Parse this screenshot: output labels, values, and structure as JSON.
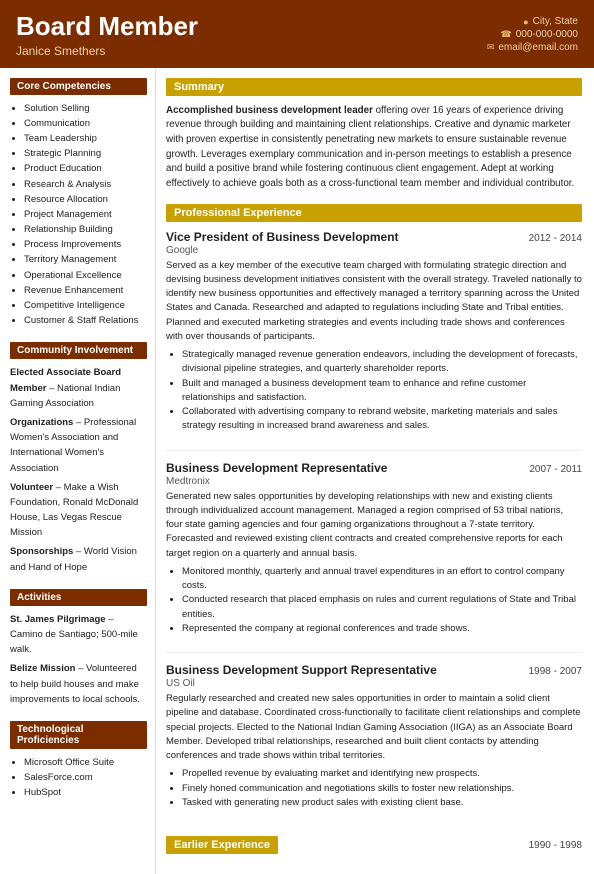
{
  "header": {
    "name": "Board Member",
    "subtitle": "Janice Smethers",
    "contact": {
      "location": "City, State",
      "phone": "000-000-0000",
      "email": "email@email.com"
    }
  },
  "sidebar": {
    "core_competencies": {
      "title": "Core Competencies",
      "items": [
        "Solution Selling",
        "Communication",
        "Team Leadership",
        "Strategic Planning",
        "Product Education",
        "Research & Analysis",
        "Resource Allocation",
        "Project Management",
        "Relationship Building",
        "Process Improvements",
        "Territory Management",
        "Operational Excellence",
        "Revenue Enhancement",
        "Competitive Intelligence",
        "Customer & Staff Relations"
      ]
    },
    "community": {
      "title": "Community Involvement",
      "items": [
        {
          "bold": "Elected Associate Board Member",
          "normal": " – National Indian Gaming Association"
        },
        {
          "bold": "Organizations",
          "normal": " – Professional Women's Association and International Women's Association"
        },
        {
          "bold": "Volunteer",
          "normal": " – Make a Wish Foundation, Ronald McDonald House, Las Vegas Rescue Mission"
        },
        {
          "bold": "Sponsorships",
          "normal": " – World Vision and Hand of Hope"
        }
      ]
    },
    "activities": {
      "title": "Activities",
      "items": [
        {
          "bold": "St. James Pilgrimage",
          "normal": " – Camino de Santiago; 500-mile walk."
        },
        {
          "bold": "Belize Mission",
          "normal": " – Volunteered to help build houses and make improvements to local schools."
        }
      ]
    },
    "tech": {
      "title": "Technological Proficiencies",
      "items": [
        "Microsoft Office Suite",
        "SalesForce.com",
        "HubSpot"
      ]
    }
  },
  "content": {
    "summary": {
      "title": "Summary",
      "text_bold": "Accomplished business development leader",
      "text_rest": " offering over 16 years of experience driving revenue through building and maintaining client relationships. Creative and dynamic marketer with proven expertise in consistently penetrating new markets to ensure sustainable revenue growth. Leverages exemplary communication and in-person meetings to establish a presence and build a positive brand while fostering continuous client engagement. Adept at working effectively to achieve goals both as a cross-functional team member and individual contributor."
    },
    "experience": {
      "title": "Professional Experience",
      "jobs": [
        {
          "title": "Vice President of Business Development",
          "dates": "2012 - 2014",
          "company": "Google",
          "description": "Served as a key member of the executive team charged with formulating strategic direction and devising business development initiatives consistent with the overall strategy. Traveled nationally to identify new business opportunities and effectively managed a territory spanning across the United States and Canada. Researched and adapted to regulations including State and Tribal entities. Planned and executed marketing strategies and events including trade shows and conferences with over thousands of participants.",
          "bullets": [
            "Strategically managed revenue generation endeavors, including the development of forecasts, divisional pipeline strategies, and quarterly shareholder reports.",
            "Built and managed a business development team to enhance and refine customer relationships and satisfaction.",
            "Collaborated with advertising company to rebrand website, marketing materials and sales strategy resulting in increased brand awareness and sales."
          ]
        },
        {
          "title": "Business Development Representative",
          "dates": "2007 - 2011",
          "company": "Medtronix",
          "description": "Generated new sales opportunities by developing relationships with new and existing clients through individualized account management. Managed a region comprised of 53 tribal nations, four state gaming agencies and four gaming organizations throughout a 7-state territory. Forecasted and reviewed existing client contracts and created comprehensive reports for each target region on a quarterly and annual basis.",
          "bullets": [
            "Monitored monthly, quarterly and annual travel expenditures in an effort to control company costs.",
            "Conducted research that placed emphasis on rules and current regulations of State and Tribal entities.",
            "Represented the company at regional conferences and trade shows."
          ]
        },
        {
          "title": "Business Development Support Representative",
          "dates": "1998 - 2007",
          "company": "US Oil",
          "description": "Regularly researched and created new sales opportunities in order to maintain a solid client pipeline and database. Coordinated cross-functionally to facilitate client relationships and complete special projects. Elected to the National Indian Gaming Association (IIGA) as an Associate Board Member. Developed tribal relationships, researched and built client contacts by attending conferences and trade shows within tribal territories.",
          "bullets": [
            "Propelled revenue by evaluating market and identifying new prospects.",
            "Finely honed communication and negotiations skills to foster new relationships.",
            "Tasked with generating new product sales with existing client base."
          ]
        }
      ]
    },
    "earlier": {
      "title": "Earlier Experience",
      "dates": "1990 - 1998"
    }
  }
}
